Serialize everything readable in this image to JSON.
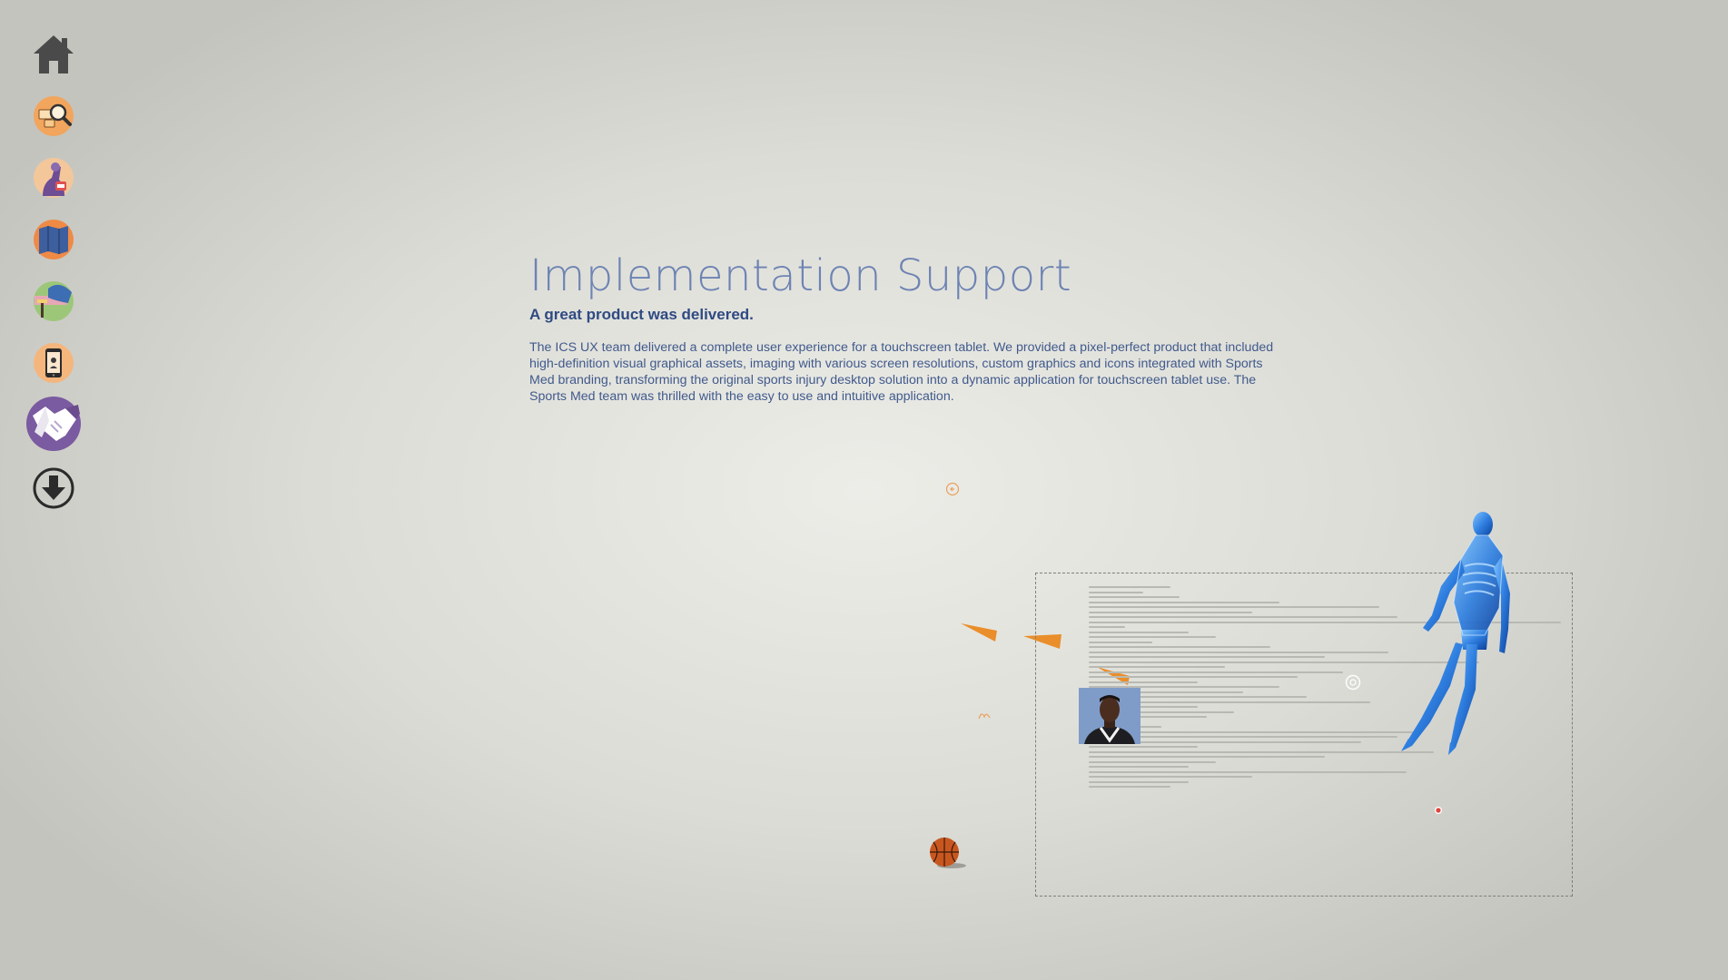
{
  "nav": {
    "items": [
      {
        "name": "home",
        "icon": "home-icon"
      },
      {
        "name": "search",
        "icon": "search-icon"
      },
      {
        "name": "research",
        "icon": "microscope-icon"
      },
      {
        "name": "map",
        "icon": "map-icon"
      },
      {
        "name": "design",
        "icon": "paint-roller-icon"
      },
      {
        "name": "mobile",
        "icon": "tablet-icon"
      },
      {
        "name": "implementation",
        "icon": "handshake-icon",
        "active": true
      },
      {
        "name": "download",
        "icon": "download-icon"
      }
    ]
  },
  "main": {
    "title": "Implementation Support",
    "subtitle": "A great product was delivered.",
    "body": "The ICS UX team delivered a complete user experience for a touchscreen tablet. We provided a pixel-perfect product that included high-definition visual graphical assets, imaging with various screen resolutions, custom graphics and icons integrated with Sports Med branding, transforming the original sports injury desktop solution into a dynamic application for touchscreen tablet use. The Sports Med team was thrilled with the easy to use and intuitive application."
  },
  "colors": {
    "title": "#6d83b3",
    "subtitle": "#2f4a82",
    "body": "#405a8c",
    "nav_orange": "#f0a45c",
    "nav_purple": "#7a5aa0",
    "accent_orange": "#e98e2a",
    "skeleton_blue": "#2f7fe0"
  }
}
